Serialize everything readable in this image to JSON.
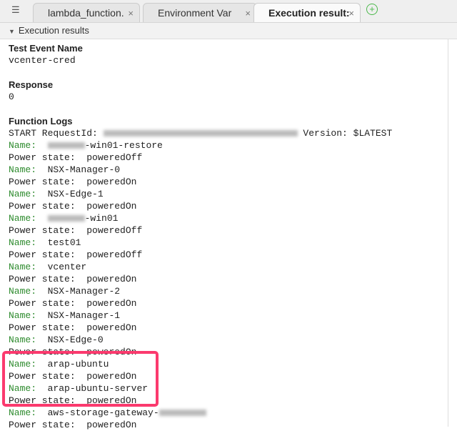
{
  "tabs": [
    {
      "label": "lambda_function.",
      "close": "×"
    },
    {
      "label": "Environment Var",
      "close": "×"
    },
    {
      "label": "Execution result:",
      "close": "×"
    }
  ],
  "add_tab": "+",
  "section": {
    "title": "Execution results"
  },
  "test_event": {
    "label": "Test Event Name",
    "value": "vcenter-cred"
  },
  "response": {
    "label": "Response",
    "value": "0"
  },
  "logs": {
    "label": "Function Logs",
    "start_prefix": "START RequestId: ",
    "start_suffix": " Version: $LATEST",
    "name_key": "Name:",
    "power_key": "Power state:",
    "entries": [
      {
        "name": "-win01-restore",
        "blur": true,
        "power": "poweredOff"
      },
      {
        "name": "NSX-Manager-0",
        "power": "poweredOn"
      },
      {
        "name": "NSX-Edge-1",
        "power": "poweredOn"
      },
      {
        "name": "-win01",
        "blur": true,
        "power": "poweredOff"
      },
      {
        "name": "test01",
        "power": "poweredOff"
      },
      {
        "name": "vcenter",
        "power": "poweredOn"
      },
      {
        "name": "NSX-Manager-2",
        "power": "poweredOn"
      },
      {
        "name": "NSX-Manager-1",
        "power": "poweredOn"
      },
      {
        "name": "NSX-Edge-0",
        "power": "poweredOn"
      },
      {
        "name": "arap-ubuntu",
        "power": "poweredOn"
      },
      {
        "name": "arap-ubuntu-server",
        "power": "poweredOn"
      },
      {
        "name": "aws-storage-gateway-",
        "blur_after": true,
        "power": "poweredOn"
      }
    ]
  },
  "highlight_color": "#fb3a6e"
}
